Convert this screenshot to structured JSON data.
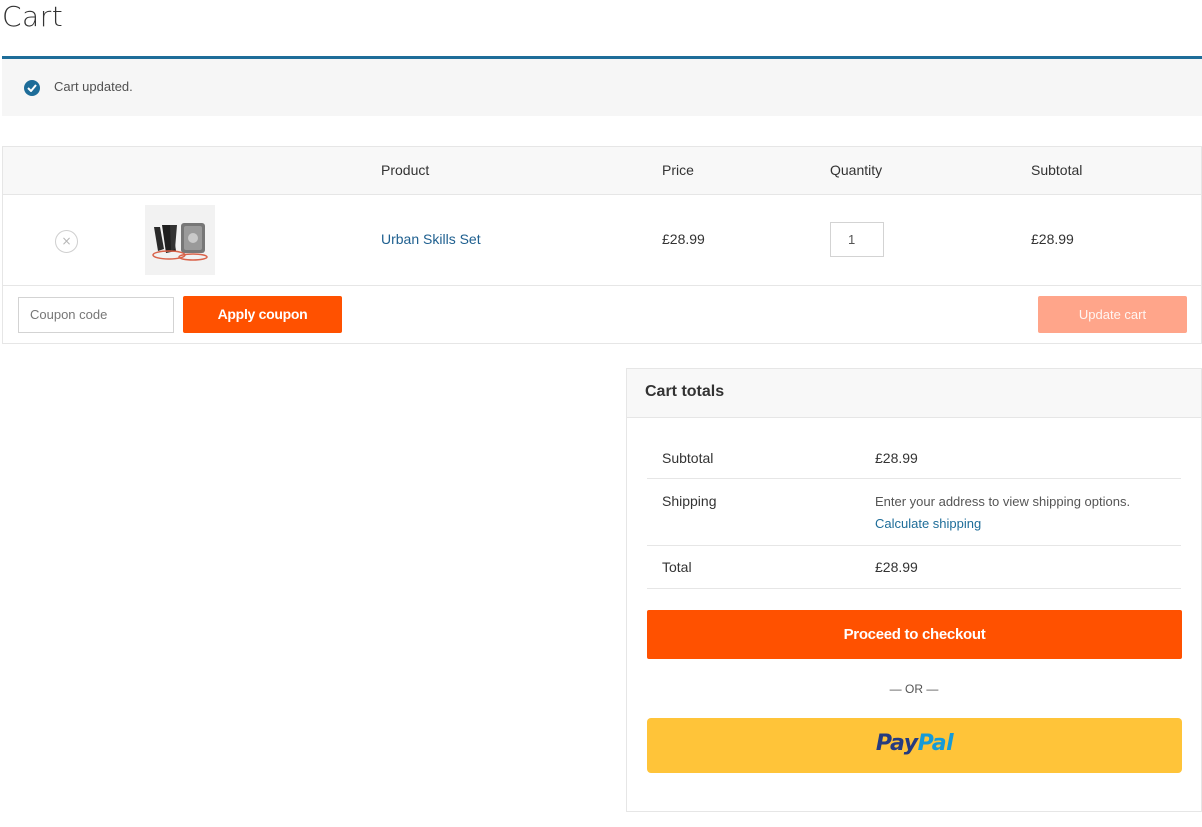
{
  "page": {
    "title": "Cart"
  },
  "notice": {
    "text": "Cart updated."
  },
  "table": {
    "headers": {
      "product": "Product",
      "price": "Price",
      "quantity": "Quantity",
      "subtotal": "Subtotal"
    },
    "items": [
      {
        "name": "Urban Skills Set",
        "price": "£28.99",
        "quantity": "1",
        "subtotal": "£28.99",
        "remove_symbol": "×"
      }
    ]
  },
  "actions": {
    "coupon_placeholder": "Coupon code",
    "apply_label": "Apply coupon",
    "update_label": "Update cart"
  },
  "totals": {
    "title": "Cart totals",
    "subtotal_label": "Subtotal",
    "subtotal_value": "£28.99",
    "shipping_label": "Shipping",
    "shipping_text": "Enter your address to view shipping options.",
    "calculate_shipping": "Calculate shipping",
    "total_label": "Total",
    "total_value": "£28.99",
    "checkout_label": "Proceed to checkout",
    "or_text": "— OR —",
    "paypal_part1": "Pay",
    "paypal_part2": "Pal"
  },
  "colors": {
    "accent": "#ff5100",
    "link": "#1e5f8f",
    "notice_border": "#1e6d99",
    "paypal_bg": "#ffc439"
  },
  "icons": {
    "notice": "check-circle-icon",
    "remove": "close-icon"
  }
}
